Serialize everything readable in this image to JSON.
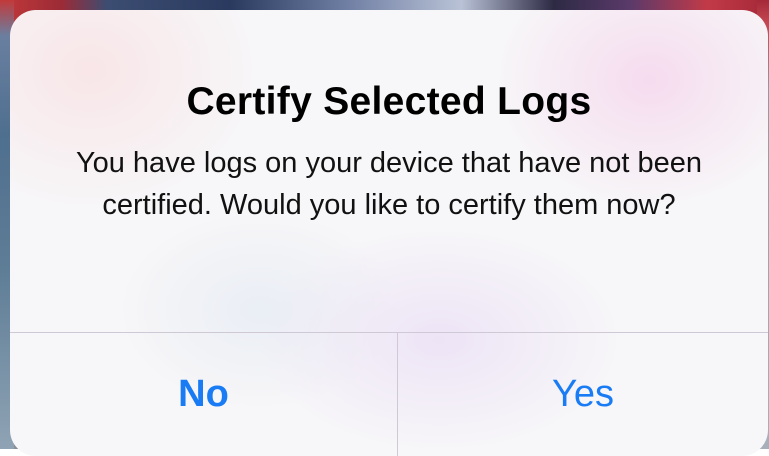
{
  "alert": {
    "title": "Certify Selected Logs",
    "message": "You have logs on your device that have not been certified. Would you like to certify them now?",
    "buttons": {
      "no_label": "No",
      "yes_label": "Yes"
    },
    "accent_color": "#1a7cf5"
  }
}
